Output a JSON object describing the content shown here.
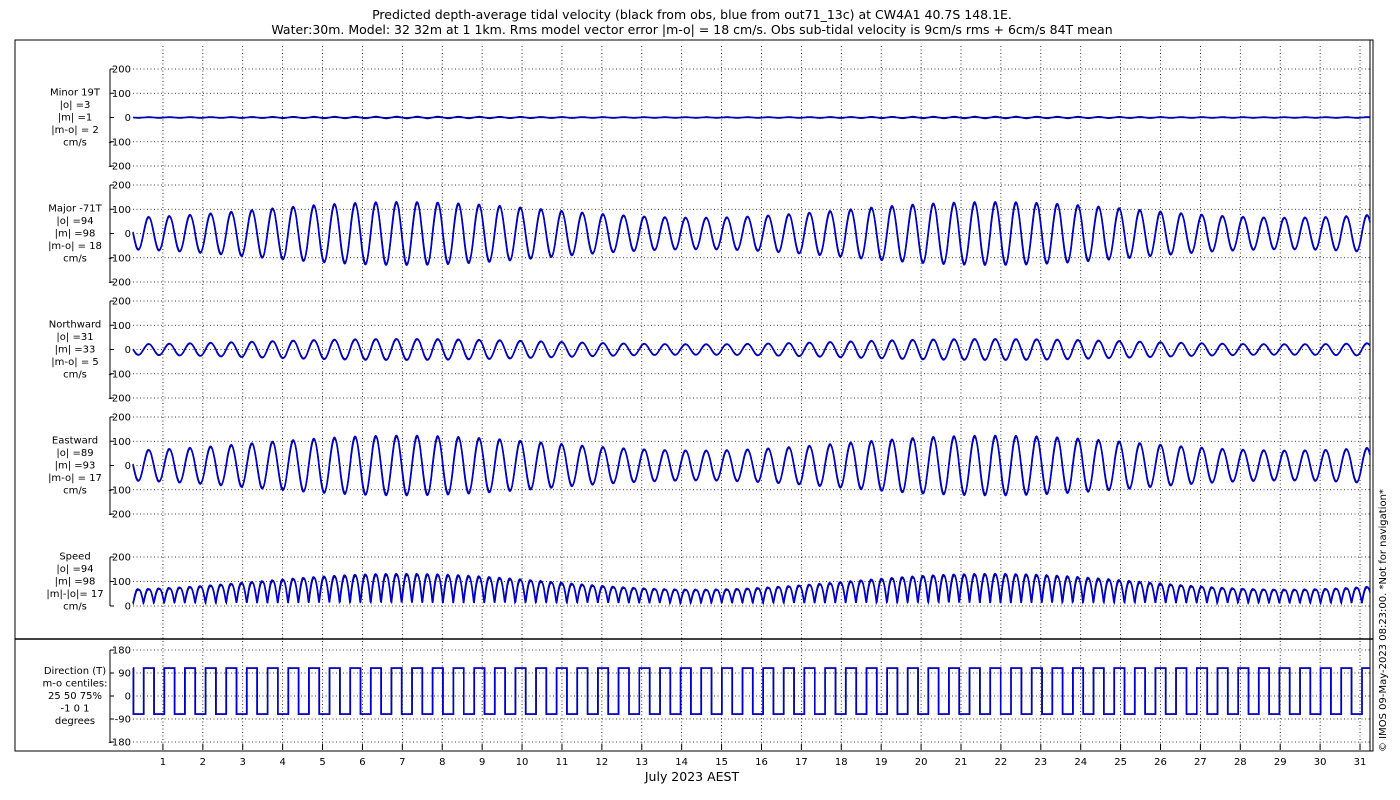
{
  "chart_data": {
    "type": "line",
    "title": [
      "Predicted depth-average tidal velocity (black from obs, blue from out71_13c) at CW4A1 40.7S 148.1E.",
      "Water:30m. Model: 32 32m at 1 1km. Rms model vector error |m-o| = 18 cm/s. Obs sub-tidal velocity is 9cm/s rms + 6cm/s 84T mean"
    ],
    "xlabel": "July 2023 AEST",
    "xlim": [
      0.25,
      31.25
    ],
    "x_ticks": [
      "1",
      "2",
      "3",
      "4",
      "5",
      "6",
      "7",
      "8",
      "9",
      "10",
      "11",
      "12",
      "13",
      "14",
      "15",
      "16",
      "17",
      "18",
      "19",
      "20",
      "21",
      "22",
      "23",
      "24",
      "25",
      "26",
      "27",
      "28",
      "29",
      "30",
      "31"
    ],
    "grid": true,
    "watermark": "© IMOS 09-May-2023 08:23:00. *Not for navigation*",
    "colors": {
      "obs": "#000000",
      "model": "#0000cc",
      "grid": "#000000"
    },
    "panels": [
      {
        "key": "minor",
        "label_lines": [
          "Minor 19T",
          "|o| =3",
          "|m| =1",
          "|m-o| = 2",
          "cm/s"
        ],
        "ylim": [
          -200,
          200
        ],
        "y_ticks": [
          "200",
          "100",
          "0",
          "-100",
          "-200"
        ],
        "series": [
          {
            "role": "obs",
            "kind": "tide",
            "amplitude": 3,
            "mean": 0
          },
          {
            "role": "model",
            "kind": "tide",
            "amplitude": 1,
            "mean": 0
          }
        ]
      },
      {
        "key": "major",
        "label_lines": [
          "Major -71T",
          "|o| =94",
          "|m| =98",
          "|m-o| = 18",
          "cm/s"
        ],
        "ylim": [
          -200,
          200
        ],
        "y_ticks": [
          "200",
          "100",
          "0",
          "-100",
          "-200"
        ],
        "series": [
          {
            "role": "obs",
            "kind": "tide",
            "amplitude": 94,
            "mean": 0
          },
          {
            "role": "model",
            "kind": "tide",
            "amplitude": 98,
            "mean": 0
          }
        ]
      },
      {
        "key": "northward",
        "label_lines": [
          "Northward",
          "|o| =31",
          "|m| =33",
          "|m-o| = 5",
          "cm/s"
        ],
        "ylim": [
          -200,
          200
        ],
        "y_ticks": [
          "200",
          "100",
          "0",
          "-100",
          "-200"
        ],
        "series": [
          {
            "role": "obs",
            "kind": "tide",
            "amplitude": 31,
            "mean": 0
          },
          {
            "role": "model",
            "kind": "tide",
            "amplitude": 33,
            "mean": 0
          }
        ]
      },
      {
        "key": "eastward",
        "label_lines": [
          "Eastward",
          "|o| =89",
          "|m| =93",
          "|m-o| = 17",
          "cm/s"
        ],
        "ylim": [
          -200,
          200
        ],
        "y_ticks": [
          "200",
          "100",
          "0",
          "-100",
          "-200"
        ],
        "series": [
          {
            "role": "obs",
            "kind": "tide",
            "amplitude": 89,
            "mean": 0
          },
          {
            "role": "model",
            "kind": "tide",
            "amplitude": 93,
            "mean": 0
          }
        ]
      },
      {
        "key": "speed",
        "label_lines": [
          "Speed",
          "|o| =94",
          "|m| =98",
          "|m|-|o|= 17",
          "cm/s"
        ],
        "ylim": [
          0,
          200
        ],
        "y_ticks": [
          "200",
          "100",
          "0"
        ],
        "series": [
          {
            "role": "obs",
            "kind": "speed",
            "amplitude": 94,
            "mean": 0
          },
          {
            "role": "model",
            "kind": "speed",
            "amplitude": 98,
            "mean": 0
          }
        ]
      },
      {
        "key": "direction",
        "label_lines": [
          "Direction (T)",
          "m-o centiles:",
          "25  50  75%",
          "-1   0   1",
          "degrees"
        ],
        "ylim": [
          -180,
          180
        ],
        "y_ticks": [
          "180",
          "90",
          "0",
          "-90",
          "-180"
        ],
        "series": [
          {
            "role": "obs",
            "kind": "direction",
            "upper": 109,
            "lower": -71
          },
          {
            "role": "model",
            "kind": "direction",
            "upper": 109,
            "lower": -71
          }
        ]
      }
    ]
  }
}
